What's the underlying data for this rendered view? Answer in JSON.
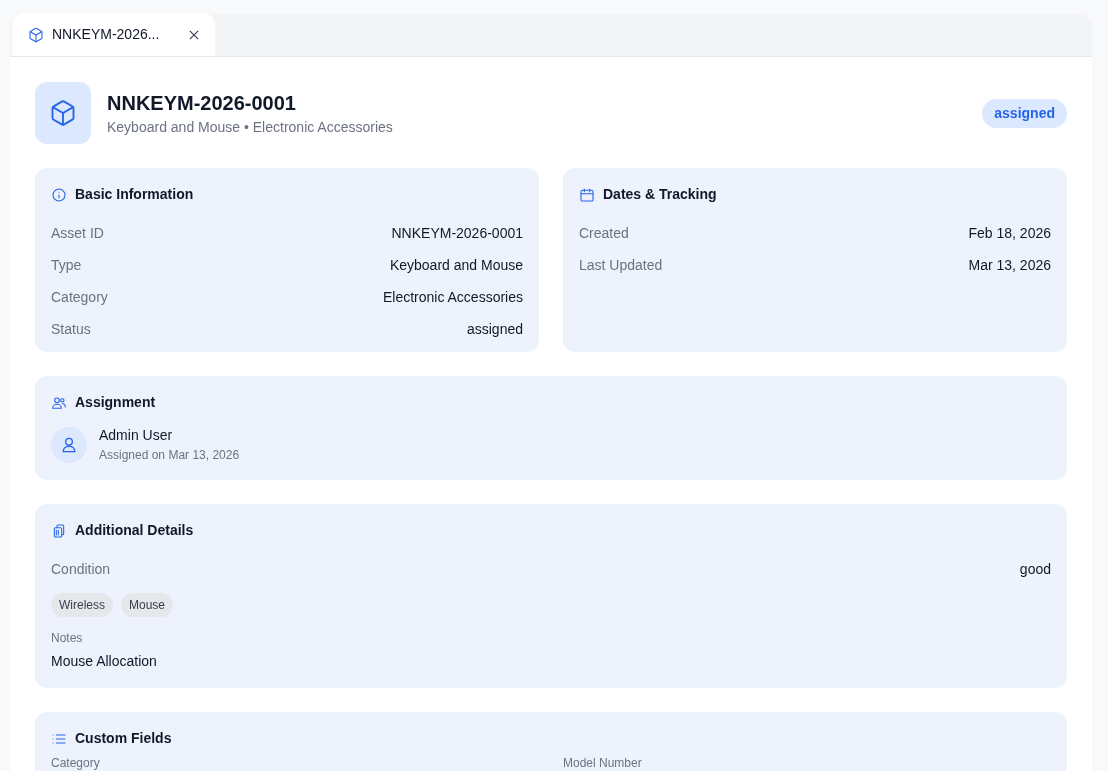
{
  "tabs": [
    {
      "label": "NNKEYM-2026...",
      "selected": true
    }
  ],
  "header": {
    "title": "NNKEYM-2026-0001",
    "subtitle": "Keyboard and Mouse • Electronic Accessories",
    "status": "assigned"
  },
  "basic_information": {
    "title": "Basic Information",
    "rows": [
      {
        "label": "Asset ID",
        "value": "NNKEYM-2026-0001"
      },
      {
        "label": "Type",
        "value": "Keyboard and Mouse"
      },
      {
        "label": "Category",
        "value": "Electronic Accessories"
      },
      {
        "label": "Status",
        "value": "assigned"
      }
    ]
  },
  "dates_tracking": {
    "title": "Dates & Tracking",
    "rows": [
      {
        "label": "Created",
        "value": "Feb 18, 2026"
      },
      {
        "label": "Last Updated",
        "value": "Mar 13, 2026"
      }
    ]
  },
  "assignment": {
    "title": "Assignment",
    "user": "Admin User",
    "assigned_on": "Assigned on Mar 13, 2026"
  },
  "additional_details": {
    "title": "Additional Details",
    "condition_label": "Condition",
    "condition": "good",
    "tags": [
      "Wireless",
      "Mouse"
    ],
    "notes_label": "Notes",
    "notes": "Mouse Allocation"
  },
  "custom_fields": {
    "title": "Custom Fields",
    "labels": [
      "Category",
      "Model Number"
    ]
  }
}
